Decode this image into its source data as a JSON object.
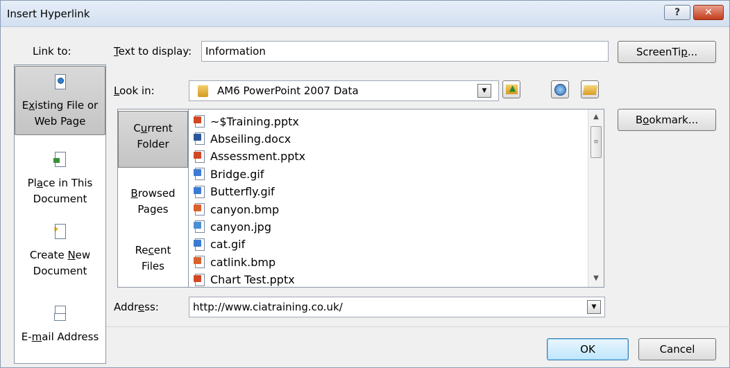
{
  "window": {
    "title": "Insert Hyperlink",
    "help_glyph": "?",
    "close_glyph": "✕"
  },
  "link_to": {
    "heading": "Link to:",
    "items": [
      {
        "pre": "E",
        "u": "x",
        "post": "isting File or",
        "line2": "Web Page",
        "icon": "existing-file-icon"
      },
      {
        "pre": "Pl",
        "u": "a",
        "post": "ce in This",
        "line2": "Document",
        "icon": "place-in-document-icon"
      },
      {
        "pre": "Create ",
        "u": "N",
        "post": "ew",
        "line2": "Document",
        "icon": "new-document-icon"
      },
      {
        "pre": "E-",
        "u": "m",
        "post": "ail Address",
        "line2": "",
        "icon": "email-icon"
      }
    ]
  },
  "text_to_display": {
    "label_u": "T",
    "label_rest": "ext to display:",
    "value": "Information"
  },
  "screentip_button": {
    "pre": "ScreenTi",
    "u": "p",
    "post": "..."
  },
  "look_in": {
    "label_u": "L",
    "label_rest": "ook in:",
    "value": "AM6 PowerPoint 2007 Data",
    "arrow": "▼"
  },
  "folder_nav": [
    {
      "pre": "C",
      "u": "u",
      "post": "rrent",
      "line2": "Folder"
    },
    {
      "pre": "",
      "u": "B",
      "post": "rowsed",
      "line2": "Pages"
    },
    {
      "pre": "Re",
      "u": "c",
      "post": "ent",
      "line2": "Files"
    }
  ],
  "files": [
    {
      "name": "~$Training.pptx",
      "type": "pptx"
    },
    {
      "name": "Abseiling.docx",
      "type": "docx"
    },
    {
      "name": "Assessment.pptx",
      "type": "pptx"
    },
    {
      "name": "Bridge.gif",
      "type": "gif"
    },
    {
      "name": "Butterfly.gif",
      "type": "gif"
    },
    {
      "name": "canyon.bmp",
      "type": "bmp"
    },
    {
      "name": "canyon.jpg",
      "type": "jpg"
    },
    {
      "name": "cat.gif",
      "type": "gif"
    },
    {
      "name": "catlink.bmp",
      "type": "bmp"
    },
    {
      "name": "Chart Test.pptx",
      "type": "pptx"
    }
  ],
  "scrollbar": {
    "up": "▲",
    "down": "▼",
    "grip": "≡"
  },
  "bookmark_button": {
    "pre": "B",
    "u": "o",
    "post": "okmark..."
  },
  "address": {
    "label_pre": "Addr",
    "label_u": "e",
    "label_post": "ss:",
    "value": "http://www.ciatraining.co.uk/",
    "arrow": "▼"
  },
  "buttons": {
    "ok": "OK",
    "cancel": "Cancel"
  },
  "colors": {
    "pptx": "#d24726",
    "docx": "#2b579a",
    "gif": "#3a7bd5",
    "bmp": "#d9622b",
    "jpg": "#4b8fd1",
    "folder": "#e8b13a"
  }
}
